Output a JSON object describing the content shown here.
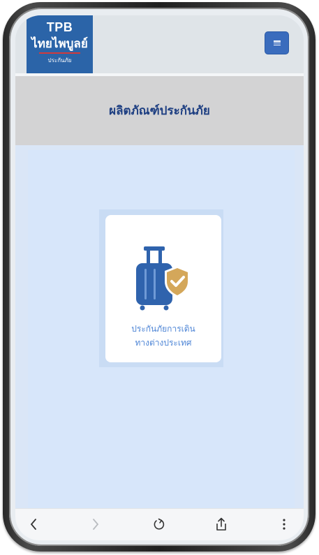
{
  "brand": {
    "name": "TPB",
    "thai_name": "ไทยไพบูลย์",
    "subtitle": "ประกันภัย",
    "color": "#2b64a8",
    "accent": "#d43a3a"
  },
  "header": {
    "menu_icon": "hamburger-menu-icon"
  },
  "page": {
    "title": "ผลิตภัณฑ์ประกันภัย"
  },
  "products": [
    {
      "icon": "luggage-shield-icon",
      "label_line1": "ประกันภัยการเดิน",
      "label_line2": "ทางต่างประเทศ"
    }
  ],
  "browser_toolbar": {
    "items": [
      "back-icon",
      "forward-icon",
      "reload-icon",
      "share-icon",
      "more-icon"
    ]
  },
  "colors": {
    "title_text": "#1e3f82",
    "product_label": "#4f86d6",
    "content_bg": "#d7e6fa",
    "menu_button": "#3a6cbd",
    "shield": "#d4a75a",
    "luggage": "#2f63ad"
  }
}
